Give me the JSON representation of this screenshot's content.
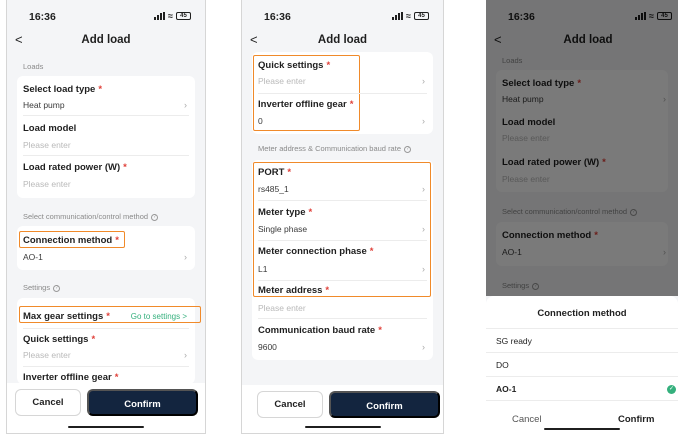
{
  "status": {
    "time": "16:36",
    "battery": "45"
  },
  "header": {
    "back": "<",
    "title": "Add load"
  },
  "screen1": {
    "loads_section": "Loads",
    "load_type": {
      "label": "Select load type",
      "value": "Heat pump"
    },
    "load_model": {
      "label": "Load model",
      "placeholder": "Please enter"
    },
    "rated_power": {
      "label": "Load rated power (W)",
      "placeholder": "Please enter"
    },
    "comm_section": "Select communication/control method",
    "connection": {
      "label": "Connection method",
      "value": "AO-1"
    },
    "settings_section": "Settings",
    "max_gear": {
      "label": "Max gear settings",
      "link": "Go to settings >"
    },
    "quick": {
      "label": "Quick settings",
      "placeholder": "Please enter"
    },
    "offline_gear": {
      "label": "Inverter offline gear"
    }
  },
  "screen2": {
    "quick": {
      "label": "Quick settings",
      "placeholder": "Please enter"
    },
    "offline_gear": {
      "label": "Inverter offline gear",
      "value": "0"
    },
    "meter_section": "Meter address & Communication baud rate",
    "port": {
      "label": "PORT",
      "value": "rs485_1"
    },
    "meter_type": {
      "label": "Meter type",
      "value": "Single phase"
    },
    "meter_phase": {
      "label": "Meter connection phase",
      "value": "L1"
    },
    "meter_address": {
      "label": "Meter address",
      "placeholder": "Please enter"
    },
    "baud": {
      "label": "Communication baud rate",
      "value": "9600"
    }
  },
  "screen3": {
    "sheet_title": "Connection method",
    "options": [
      "SG ready",
      "DO",
      "AO-1"
    ],
    "selected": "AO-1"
  },
  "buttons": {
    "cancel": "Cancel",
    "confirm": "Confirm"
  },
  "colors": {
    "accent": "#35b07d",
    "confirm_bg": "#13253f",
    "highlight": "#f08a2a",
    "required": "#e0413a"
  },
  "icons": [
    "signal-icon",
    "wifi-icon",
    "battery-icon",
    "back-chevron-icon",
    "chevron-right-icon",
    "info-icon",
    "check-icon"
  ]
}
